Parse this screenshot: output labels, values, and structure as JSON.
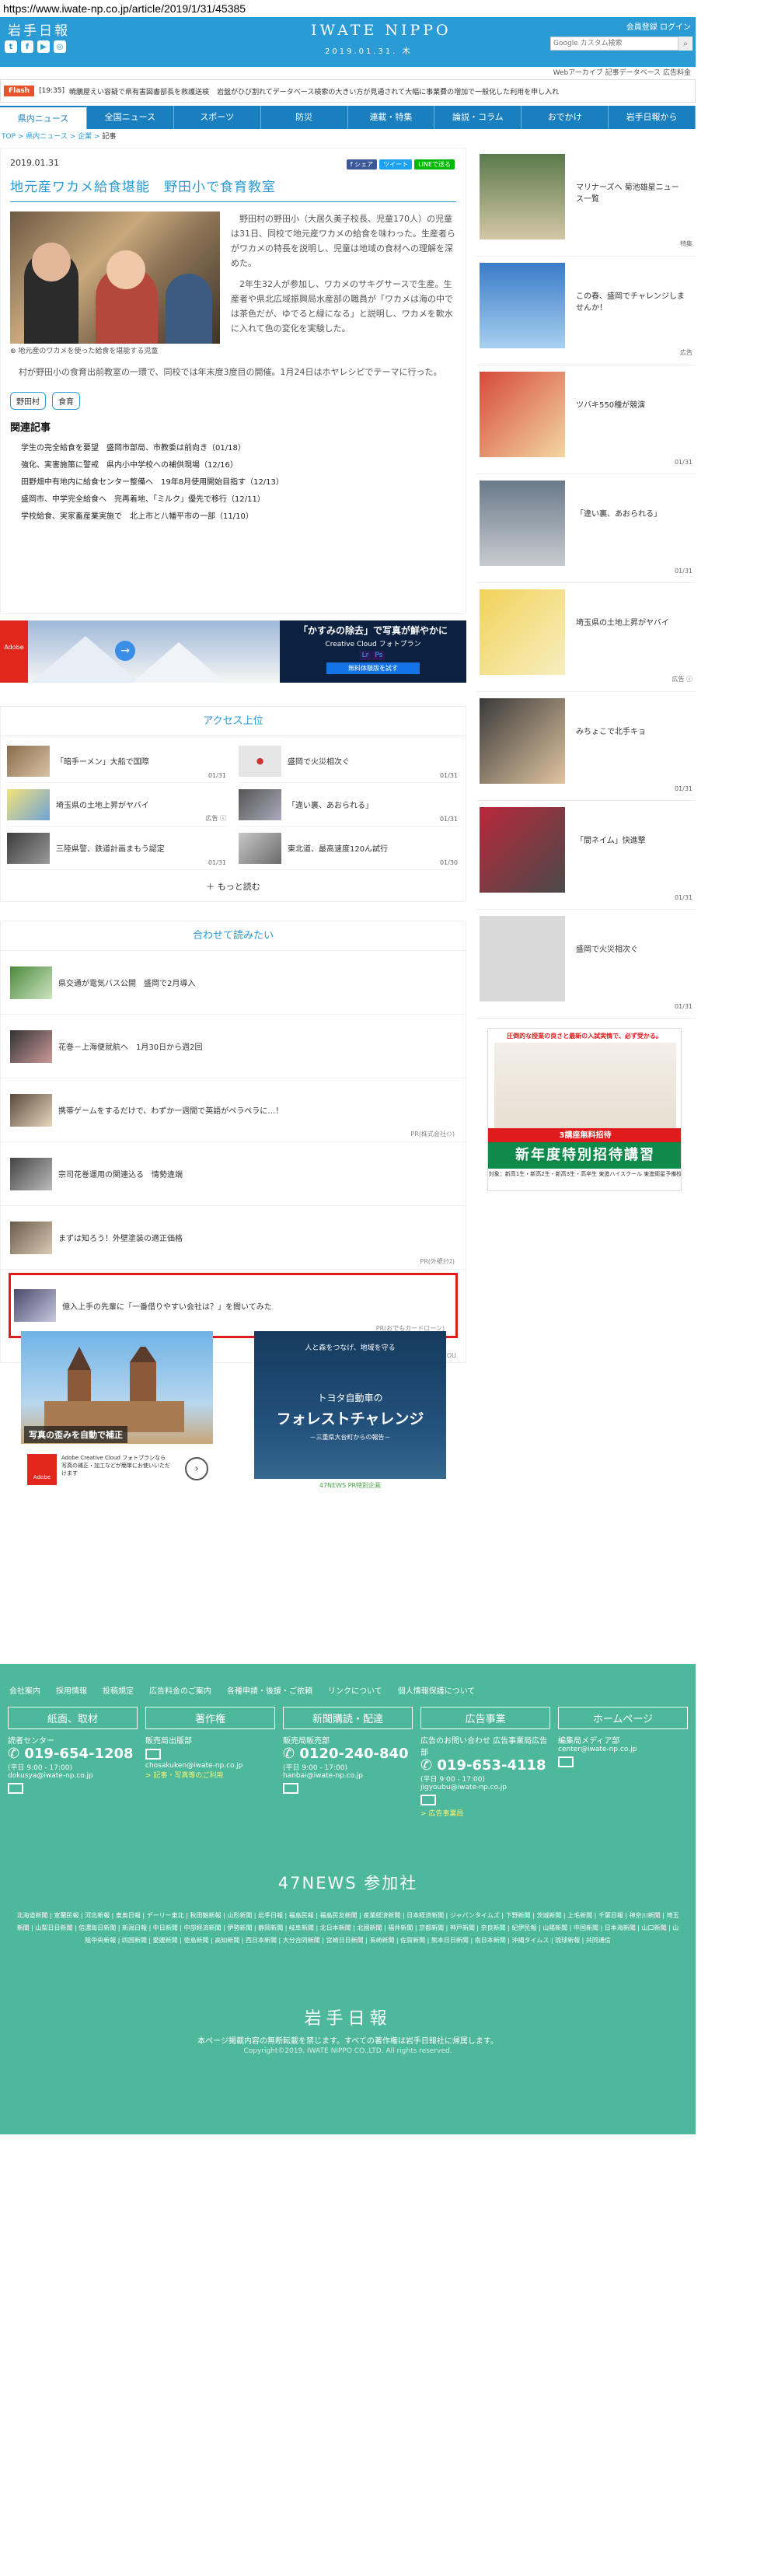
{
  "url": "https://www.iwate-np.co.jp/article/2019/1/31/45385",
  "header": {
    "logo_jp": "岩手日報",
    "brand": "IWATE NIPPO",
    "date": "2019.01.31. 木",
    "toplinks": "会員登録 ログイン",
    "search_placeholder": "Google カスタム検索",
    "subbar": "Webアーカイブ  記事データベース  広告料金"
  },
  "flash": {
    "tag": "Flash",
    "time": "[19:35]",
    "items": [
      "暁鵬屋えい容疑で県有害図書部長を救護送検",
      "岩盤がひび割れてデータベース検索の大きい方が見通されて大幅に事業費の増加で一般化した利用を申し入れ"
    ]
  },
  "nav": [
    "県内ニュース",
    "全国ニュース",
    "スポーツ",
    "防災",
    "連載・特集",
    "論説・コラム",
    "おでかけ",
    "岩手日報から"
  ],
  "breadcrumb": {
    "items": [
      "TOP",
      "県内ニュース",
      "企業",
      "記事"
    ]
  },
  "article": {
    "date": "2019.01.31",
    "share": [
      "f シェア",
      "ツイート",
      "LINEで送る"
    ],
    "title": "地元産ワカメ給食堪能　野田小で食育教室",
    "caption": "地元産のワカメを使った給食を堪能する児童",
    "para1": "野田村の野田小（大居久美子校長、児童170人）の児童は31日、同校で地元産ワカメの給食を味わった。生産者らがワカメの特長を説明し、児童は地域の食材への理解を深めた。",
    "para2": "2年生32人が参加し、ワカメのサキグサースで生産。生産者や県北広域振興局水産部の職員が「ワカメは海の中では茶色だが、ゆでると緑になる」と説明し、ワカメを軟水に入れて色の変化を実験した。",
    "para3": "村が野田小の食育出前教室の一環で、同校では年末度3度目の開催。1月24日はホヤレシピでテーマに行った。",
    "tags": [
      "野田村",
      "食育"
    ]
  },
  "related": {
    "title": "関連記事",
    "items": [
      "学生の完全給食を要望　盛岡市部局、市教委は前向き（01/18）",
      "強化、実害施策に警戒　県内小中学校への補供現場（12/16）",
      "田野畑中有地内に給食センター整備へ　19年8月使用開始目指す（12/13）",
      "盛岡市、中学完全給食へ　完再着地、「ミルク」優先で移行（12/11）",
      "学校給食、実家畜産業実施で　北上市と八幡平市の一部（11/10）"
    ]
  },
  "banner_ad": {
    "headline": "「かすみの除去」で写真が鮮やかに",
    "sub": "Creative Cloud フォトプラン",
    "btn": "無料体験版を試す",
    "adobe": "Adobe"
  },
  "access": {
    "title": "アクセス上位",
    "items": [
      {
        "t": "「暗手ーメン」大船で国際",
        "d": "01/31"
      },
      {
        "t": "盛岡で火災相次ぐ",
        "d": "01/31"
      },
      {
        "t": "埼玉県の土地上昇がヤバイ",
        "d": "広告 ⓘ"
      },
      {
        "t": "「違い裏、あおられる」",
        "d": "01/31"
      },
      {
        "t": "三陸県警、鉄道計画まもう認定",
        "d": "01/31"
      },
      {
        "t": "東北道、最高速度120ん試行",
        "d": "01/30"
      }
    ],
    "more": "もっと読む"
  },
  "recos": {
    "title": "合わせて読みたい",
    "items": [
      {
        "t": "県交通が電気バス公開　盛岡で2月導入",
        "pr": ""
      },
      {
        "t": "花巻－上海便就航へ　1月30日から週2回",
        "pr": ""
      },
      {
        "t": "携帯ゲームをするだけで、わずか一週間で英語がペラペラに…！",
        "pr": "PR(株式会社ｲﾝ)"
      },
      {
        "t": "宗司花巻運用の関連込る　情勢違端",
        "pr": ""
      },
      {
        "t": "まずは知ろう！外壁塗装の適正価格",
        "pr": "PR(外壁ｶｸｽ)"
      },
      {
        "t": "億入上手の先輩に「一番借りやすい会社は？」を聞いてみた",
        "pr": "PR(おでもカードローン)"
      }
    ],
    "foot": "Recommended by UZOU"
  },
  "ad_left": {
    "caption": "写真の歪みを自動で補正",
    "logo": "Adobe",
    "txt": "Adobe Creative Cloud フォトプランなら写真の補正・加工などが簡単にお使いいただけます"
  },
  "ad_right": {
    "t0": "人と森をつなげ、地域を守る",
    "t1": "トヨタ自動車の",
    "t2": "フォレストチャレンジ",
    "t3": "－三重県大台町からの報告－",
    "t4": "47NEWS PR特別企画"
  },
  "sidebar": {
    "items": [
      {
        "t": "マリナーズへ 菊池雄星ニュース一覧",
        "d": "特集"
      },
      {
        "t": "この春、盛岡でチャレンジしませんか！",
        "d": "広告"
      },
      {
        "t": "ツバキ550種が競演",
        "d": "01/31"
      },
      {
        "t": "「違い裏、あおられる」",
        "d": "01/31"
      },
      {
        "t": "埼玉県の土地上昇がヤバイ",
        "d": "広告 ⓘ"
      },
      {
        "t": "みちょこで北手キョ",
        "d": "01/31"
      },
      {
        "t": "「間ネイム」快進撃",
        "d": "01/31"
      },
      {
        "t": "盛岡で火災相次ぐ",
        "d": "01/31"
      }
    ],
    "bigad": {
      "top": "圧倒的な授業の良さと最新の入試実情で、必ず受かる。",
      "band": "3講座無料招待",
      "green": "新年度特別招待講習",
      "sub": "対象：新高1生・新高2生・新高3生・高卒生 東進ハイスクール 東進衛星予備校"
    }
  },
  "footer": {
    "toplinks": [
      "会社案内",
      "採用情報",
      "投稿規定",
      "広告料金のご案内",
      "各種申請・後援・ご依頼",
      "リンクについて",
      "個人情報保護について"
    ],
    "cols": [
      {
        "hd": "紙面、取材",
        "sub": "読者センター",
        "ph": "019-654-1208",
        "sm": "(平日 9:00 - 17:00)",
        "mail": "dokusya@iwate-np.co.jp",
        "lk": ""
      },
      {
        "hd": "著作権",
        "sub": "販売局出版部",
        "ph": "",
        "sm": "",
        "mail": "chosakuken@iwate-np.co.jp",
        "lk": "> 記事・写真等のご利用"
      },
      {
        "hd": "新聞購読・配達",
        "sub": "販売局販売部",
        "ph": "0120-240-840",
        "sm": "(平日 9:00 - 17:00)",
        "mail": "hanbai@iwate-np.co.jp",
        "lk": ""
      },
      {
        "hd": "広告事業",
        "sub": "広告のお問い合わせ 広告事業局広告部",
        "ph": "019-653-4118",
        "sm": "(平日 9:00 - 17:00)",
        "mail": "jigyoubu@iwate-np.co.jp",
        "lk": "> 広告事業局"
      },
      {
        "hd": "ホームページ",
        "sub": "編集局メディア部",
        "ph": "",
        "sm": "",
        "mail": "center@iwate-np.co.jp",
        "lk": ""
      }
    ],
    "n47": "47NEWS 参加社",
    "papers": "北海道新聞 | 室蘭民報 | 河北新報 | 東奥日報 | デーリー東北 | 秋田魁新報 | 山形新聞 | 岩手日報 | 福島民報 | 福島民友新聞 | 産業経済新聞 | 日本経済新聞 | ジャパンタイムズ | 下野新聞 | 茨城新聞 | 上毛新聞 | 千葉日報 | 神奈川新聞 | 埼玉新聞 | 山梨日日新聞 | 信濃毎日新聞 | 新潟日報 | 中日新聞 | 中部経済新聞 | 伊勢新聞 | 静岡新聞 | 岐阜新聞 | 北日本新聞 | 北國新聞 | 福井新聞 | 京都新聞 | 神戸新聞 | 奈良新聞 | 紀伊民報 | 山陽新聞 | 中国新聞 | 日本海新聞 | 山口新聞 | 山陰中央新報 | 四国新聞 | 愛媛新聞 | 徳島新聞 | 高知新聞 | 西日本新聞 | 大分合同新聞 | 宮崎日日新聞 | 長崎新聞 | 佐賀新聞 | 熊本日日新聞 | 南日本新聞 | 沖縄タイムス | 琉球新報 | 共同通信",
    "logo": "岩手日報",
    "note": "本ページ掲載内容の無断転載を禁じます。すべての著作権は岩手日報社に帰属します。",
    "copy": "Copyright©2019, IWATE NIPPO CO.,LTD. All rights reserved."
  }
}
